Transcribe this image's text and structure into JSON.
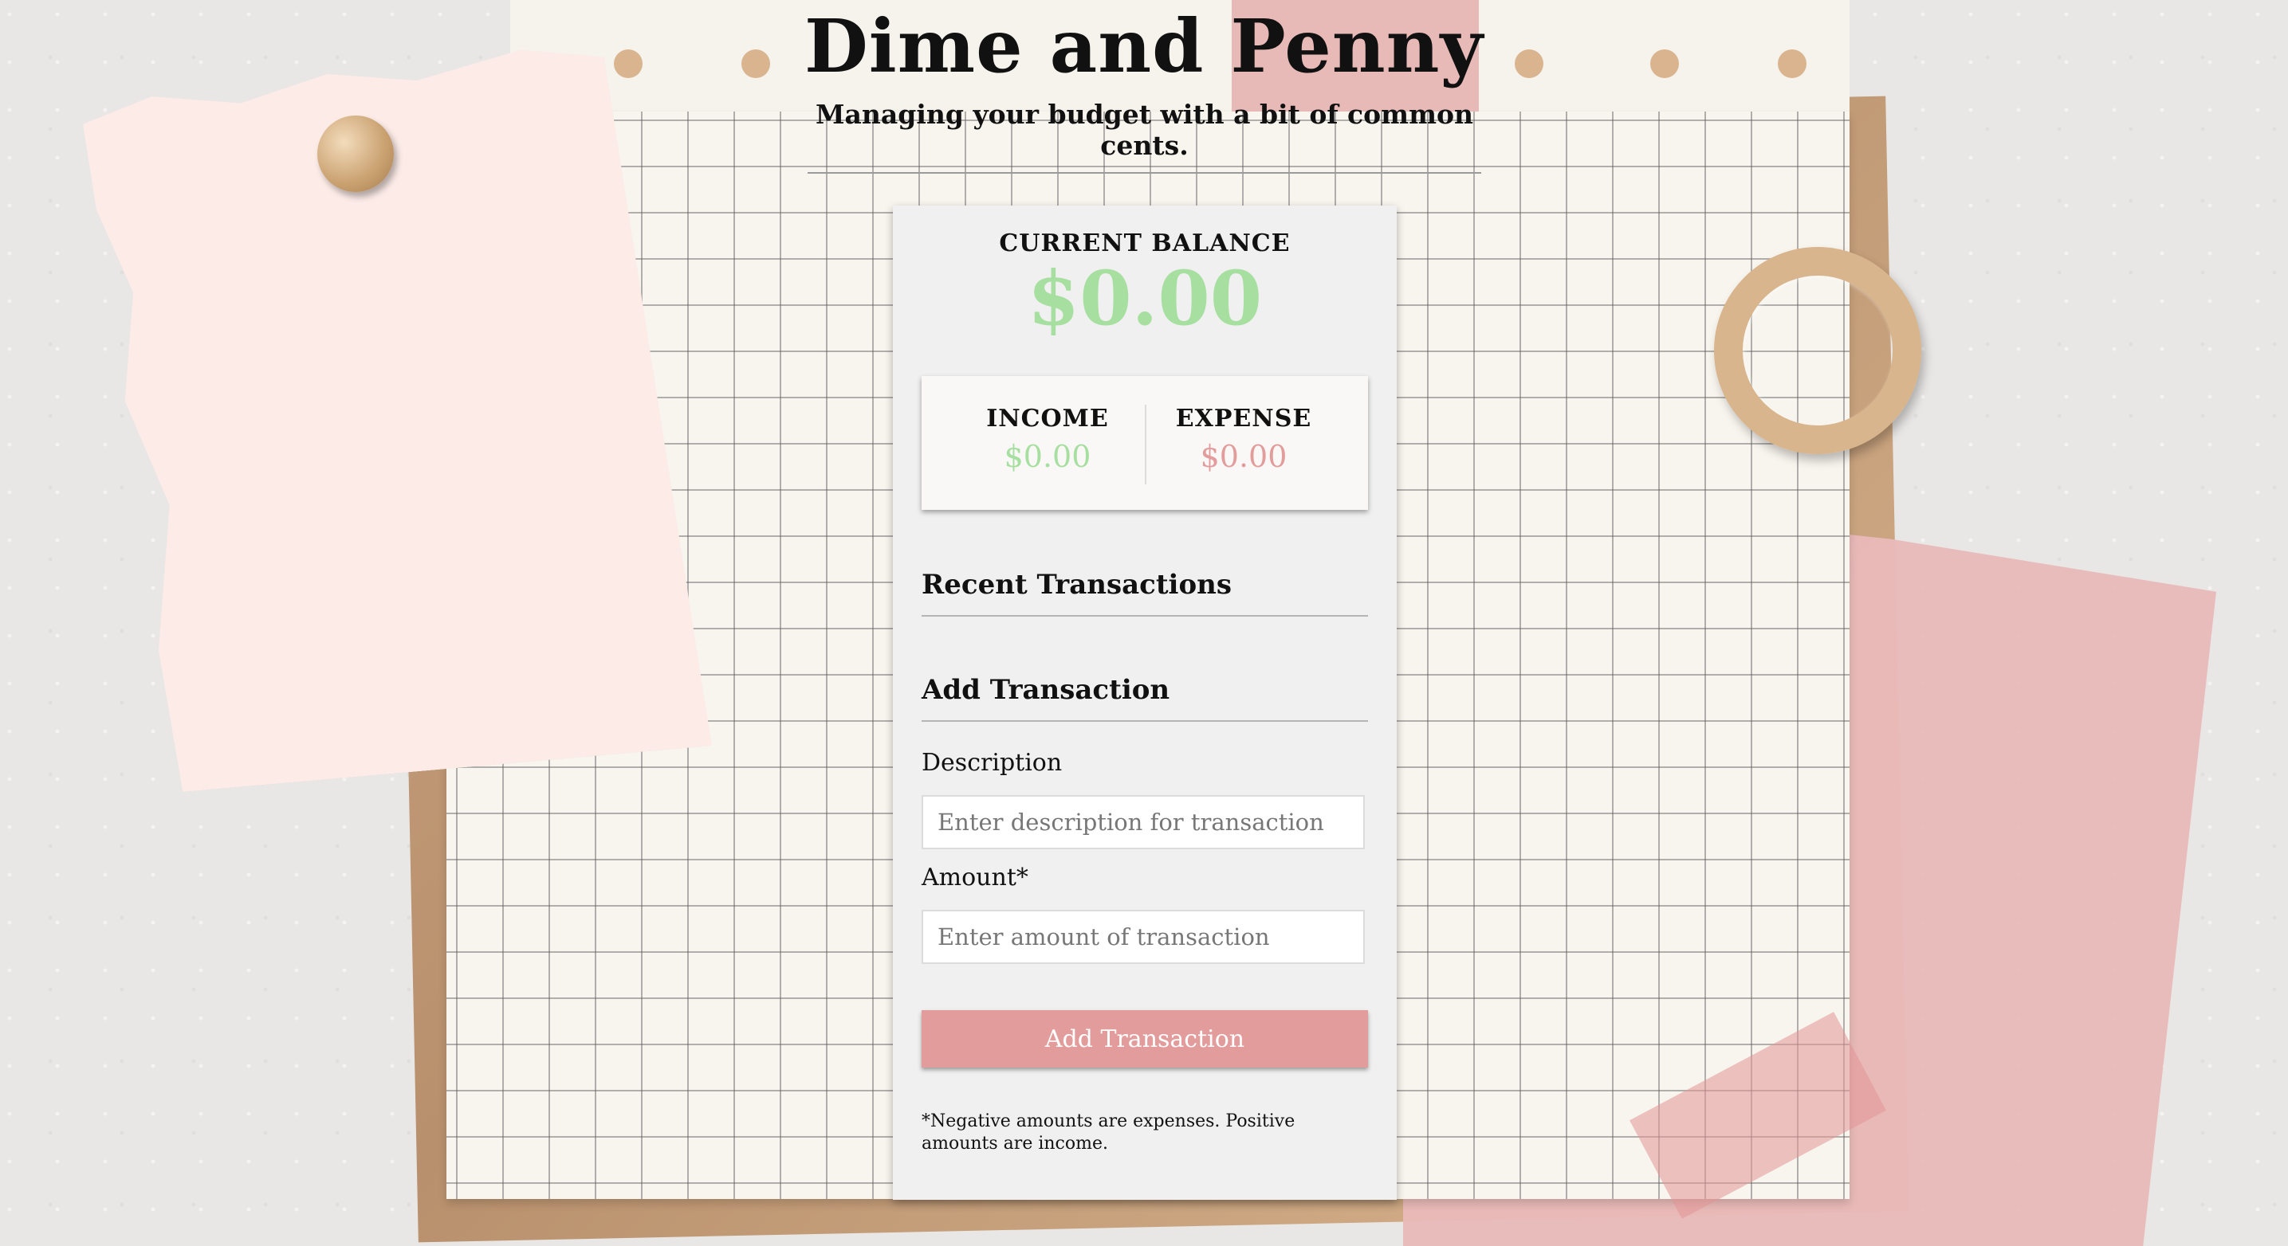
{
  "header": {
    "title": "Dime and Penny",
    "subtitle": "Managing your budget with a bit of common cents."
  },
  "balance": {
    "label": "CURRENT BALANCE",
    "value": "$0.00"
  },
  "summary": {
    "income_label": "INCOME",
    "income_value": "$0.00",
    "expense_label": "EXPENSE",
    "expense_value": "$0.00"
  },
  "sections": {
    "recent": "Recent Transactions",
    "add": "Add Transaction"
  },
  "form": {
    "description_label": "Description",
    "description_placeholder": "Enter description for transaction",
    "amount_label": "Amount*",
    "amount_placeholder": "Enter amount of transaction",
    "submit_label": "Add Transaction",
    "footnote": "*Negative amounts are expenses. Positive amounts are income."
  },
  "colors": {
    "income": "#a6dfa0",
    "expense": "#e39c9c",
    "button": "#e39c9c"
  }
}
